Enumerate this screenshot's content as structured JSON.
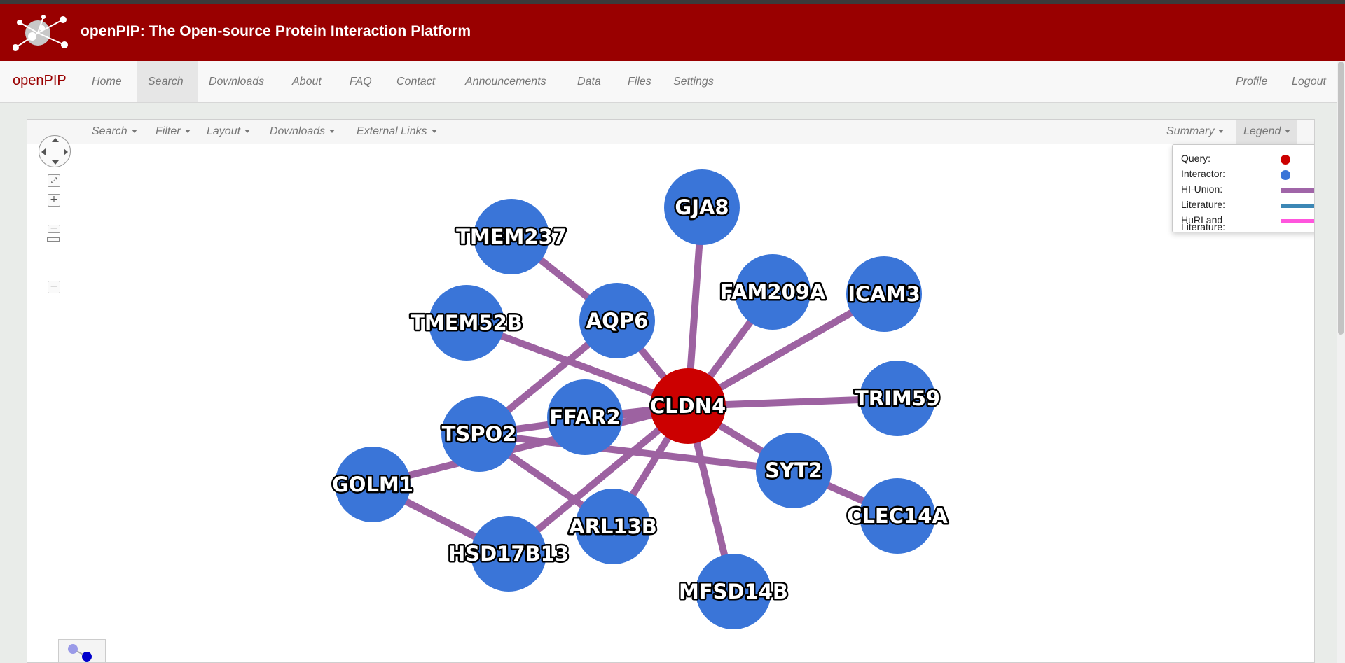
{
  "header": {
    "title": "openPIP: The Open-source Protein Interaction Platform",
    "logo_icon": "network-logo-icon"
  },
  "navbar": {
    "brand": "openPIP",
    "items": [
      {
        "label": "Home"
      },
      {
        "label": "Search",
        "active": true
      },
      {
        "label": "Downloads"
      },
      {
        "label": "About"
      },
      {
        "label": "FAQ"
      },
      {
        "label": "Contact"
      },
      {
        "label": "Announcements"
      },
      {
        "label": "Data"
      },
      {
        "label": "Files"
      },
      {
        "label": "Settings"
      }
    ],
    "right_items": [
      {
        "label": "Profile"
      },
      {
        "label": "Logout"
      }
    ]
  },
  "toolbar": {
    "left": [
      {
        "label": "Search"
      },
      {
        "label": "Filter"
      },
      {
        "label": "Layout"
      },
      {
        "label": "Downloads"
      },
      {
        "label": "External Links"
      }
    ],
    "right": [
      {
        "label": "Summary"
      },
      {
        "label": "Legend",
        "active": true
      }
    ]
  },
  "legend": {
    "query": "Query:",
    "interactor": "Interactor:",
    "hi_union": "HI-Union:",
    "literature": "Literature:",
    "huri_and": "HuRI and",
    "huri_literature": "Literature:",
    "colors": {
      "query": "#cc0000",
      "interactor": "#3a75d8",
      "hi_union": "#a065a8",
      "literature": "#3c87b5",
      "huri_literature": "#ff55dd"
    }
  },
  "network": {
    "query_color": "#cc0000",
    "interactor_color": "#3a75d8",
    "edge_color": "#9d62a1",
    "nodes": [
      {
        "id": "CLDN4",
        "label": "CLDN4",
        "type": "query"
      },
      {
        "id": "GJA8",
        "label": "GJA8",
        "type": "interactor"
      },
      {
        "id": "TMEM237",
        "label": "TMEM237",
        "type": "interactor"
      },
      {
        "id": "AQP6",
        "label": "AQP6",
        "type": "interactor"
      },
      {
        "id": "TMEM52B",
        "label": "TMEM52B",
        "type": "interactor"
      },
      {
        "id": "FAM209A",
        "label": "FAM209A",
        "type": "interactor"
      },
      {
        "id": "ICAM3",
        "label": "ICAM3",
        "type": "interactor"
      },
      {
        "id": "TRIM59",
        "label": "TRIM59",
        "type": "interactor"
      },
      {
        "id": "FFAR2",
        "label": "FFAR2",
        "type": "interactor"
      },
      {
        "id": "TSPO2",
        "label": "TSPO2",
        "type": "interactor"
      },
      {
        "id": "SYT2",
        "label": "SYT2",
        "type": "interactor"
      },
      {
        "id": "GOLM1",
        "label": "GOLM1",
        "type": "interactor"
      },
      {
        "id": "CLEC14A",
        "label": "CLEC14A",
        "type": "interactor"
      },
      {
        "id": "ARL13B",
        "label": "ARL13B",
        "type": "interactor"
      },
      {
        "id": "HSD17B13",
        "label": "HSD17B13",
        "type": "interactor"
      },
      {
        "id": "MFSD14B",
        "label": "MFSD14B",
        "type": "interactor"
      }
    ],
    "edges": [
      [
        "CLDN4",
        "GJA8"
      ],
      [
        "CLDN4",
        "AQP6"
      ],
      [
        "CLDN4",
        "TMEM52B"
      ],
      [
        "CLDN4",
        "FAM209A"
      ],
      [
        "CLDN4",
        "ICAM3"
      ],
      [
        "CLDN4",
        "TRIM59"
      ],
      [
        "CLDN4",
        "FFAR2"
      ],
      [
        "CLDN4",
        "TSPO2"
      ],
      [
        "CLDN4",
        "SYT2"
      ],
      [
        "CLDN4",
        "GOLM1"
      ],
      [
        "CLDN4",
        "ARL13B"
      ],
      [
        "CLDN4",
        "HSD17B13"
      ],
      [
        "CLDN4",
        "MFSD14B"
      ],
      [
        "TMEM237",
        "AQP6"
      ],
      [
        "AQP6",
        "TSPO2"
      ],
      [
        "TSPO2",
        "SYT2"
      ],
      [
        "TSPO2",
        "ARL13B"
      ],
      [
        "GOLM1",
        "HSD17B13"
      ],
      [
        "SYT2",
        "CLEC14A"
      ],
      [
        "AQP6",
        "CLDN4"
      ]
    ]
  }
}
